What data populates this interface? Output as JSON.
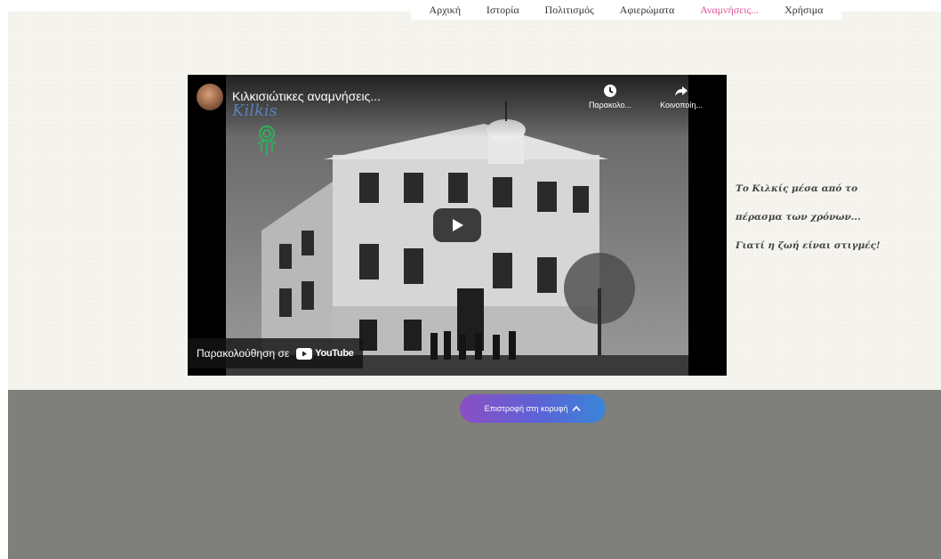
{
  "nav": {
    "items": [
      {
        "label": "Αρχική"
      },
      {
        "label": "Ιστορία"
      },
      {
        "label": "Πολιτισμός"
      },
      {
        "label": "Αφιερώματα"
      },
      {
        "label": "Αναμνήσεις..."
      },
      {
        "label": "Χρήσιμα"
      }
    ],
    "active_index": 4,
    "active_color": "#e0559d"
  },
  "video": {
    "title": "Κιλκισιώτικες αναμνήσεις...",
    "logo_text": "Kilkis",
    "watch_later_label": "Παρακολο...",
    "share_label": "Κοινοποίη...",
    "watch_on_label": "Παρακολούθηση σε",
    "youtube_label": "YouTube",
    "icons": {
      "watch_later": "clock-icon",
      "share": "share-arrow-icon",
      "play": "play-icon",
      "youtube": "youtube-logo-icon"
    }
  },
  "caption": {
    "lines": [
      "Το Κιλκίς μέσα από το",
      "πέρασμα των χρόνων...",
      "Γιατί η ζωή είναι στιγμές!"
    ]
  },
  "back_to_top": {
    "label": "Επιστροφή στη κορυφή",
    "icon": "chevron-up-icon"
  },
  "colors": {
    "page_background": "#f6f4ef",
    "footer": "#7f7f7b",
    "button_gradient_start": "#8b4fc4",
    "button_gradient_end": "#3a86d8"
  }
}
